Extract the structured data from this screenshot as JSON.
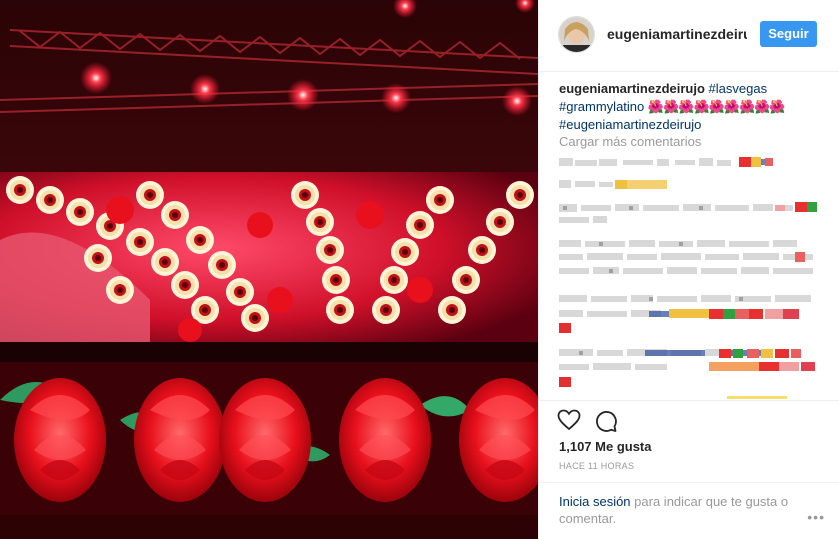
{
  "post": {
    "username": "eugeniamartinezdeirujo",
    "follow_label": "Seguir",
    "caption": {
      "username": "eugeniamartinezdeirujo",
      "hashtags": [
        "#lasvegas",
        "#grammylatino",
        "#eugeniamartinezdeirujo"
      ],
      "emoji": "🌺🌺🌺🌺🌺🌺🌺🌺🌺"
    },
    "load_more_label": "Cargar más comentarios",
    "likes": "1,107 Me gusta",
    "timestamp": "HACE 11 HORAS",
    "login_prompt": {
      "link": "Inicia sesión",
      "text": "para indicar que te gusta o comentar."
    },
    "more_label": "•••",
    "icons": [
      "heart-icon",
      "comment-icon",
      "more-options-icon"
    ],
    "colors": {
      "follow_button": "#3897f0",
      "hashtag": "#003569",
      "muted": "#999999"
    }
  }
}
